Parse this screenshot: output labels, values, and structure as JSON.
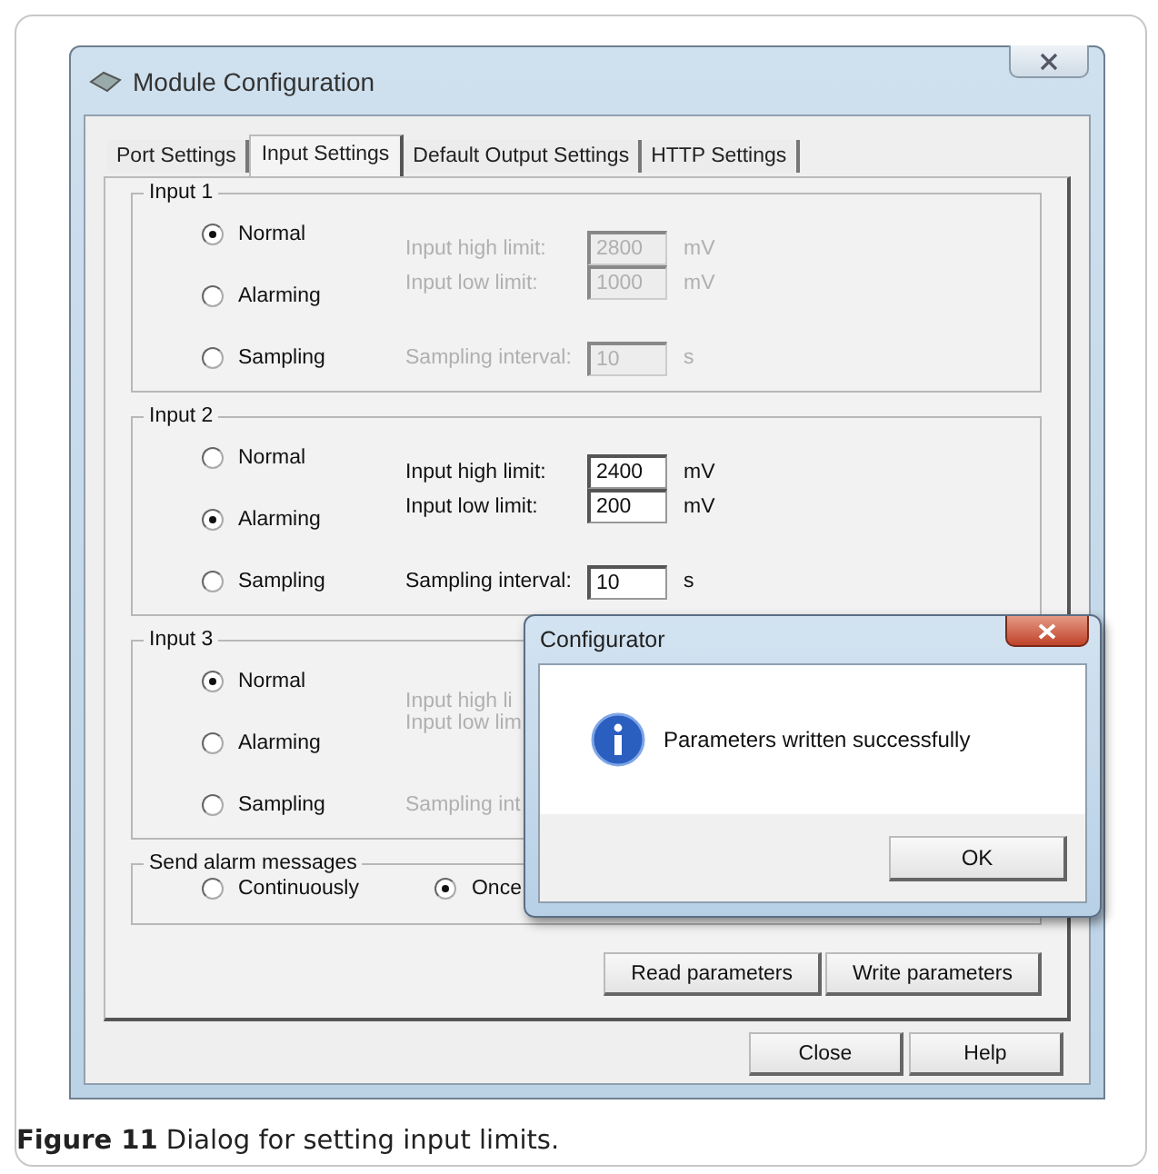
{
  "window": {
    "title": "Module Configuration"
  },
  "tabs": [
    {
      "label": "Port Settings",
      "selected": false
    },
    {
      "label": "Input Settings",
      "selected": true
    },
    {
      "label": "Default Output Settings",
      "selected": false
    },
    {
      "label": "HTTP Settings",
      "selected": false
    }
  ],
  "inputs": [
    {
      "title": "Input 1",
      "enabled": false,
      "options": [
        {
          "label": "Normal",
          "selected": true
        },
        {
          "label": "Alarming",
          "selected": false
        },
        {
          "label": "Sampling",
          "selected": false
        }
      ],
      "fields": [
        {
          "label": "Input high limit:",
          "value": "2800",
          "unit": "mV"
        },
        {
          "label": "Input low limit:",
          "value": "1000",
          "unit": "mV"
        },
        {
          "label": "Sampling interval:",
          "value": "10",
          "unit": "s"
        }
      ]
    },
    {
      "title": "Input 2",
      "enabled": true,
      "options": [
        {
          "label": "Normal",
          "selected": false
        },
        {
          "label": "Alarming",
          "selected": true
        },
        {
          "label": "Sampling",
          "selected": false
        }
      ],
      "fields": [
        {
          "label": "Input high limit:",
          "value": "2400",
          "unit": "mV"
        },
        {
          "label": "Input low limit:",
          "value": "200",
          "unit": "mV"
        },
        {
          "label": "Sampling interval:",
          "value": "10",
          "unit": "s"
        }
      ]
    },
    {
      "title": "Input 3",
      "enabled": false,
      "options": [
        {
          "label": "Normal",
          "selected": true
        },
        {
          "label": "Alarming",
          "selected": false
        },
        {
          "label": "Sampling",
          "selected": false
        }
      ],
      "fields": [
        {
          "label": "Input high li"
        },
        {
          "label": "Input low lim"
        },
        {
          "label": "Sampling int"
        }
      ]
    }
  ],
  "alarm_messages": {
    "title": "Send alarm messages",
    "options": [
      {
        "label": "Continuously",
        "selected": false
      },
      {
        "label": "Once",
        "selected": true
      }
    ]
  },
  "panel_buttons": [
    "Read parameters",
    "Write parameters"
  ],
  "window_buttons": [
    "Close",
    "Help"
  ],
  "message_box": {
    "title": "Configurator",
    "message": "Parameters written successfully",
    "button": "OK"
  },
  "caption": "**Figure 11** Dialog for setting input limits."
}
